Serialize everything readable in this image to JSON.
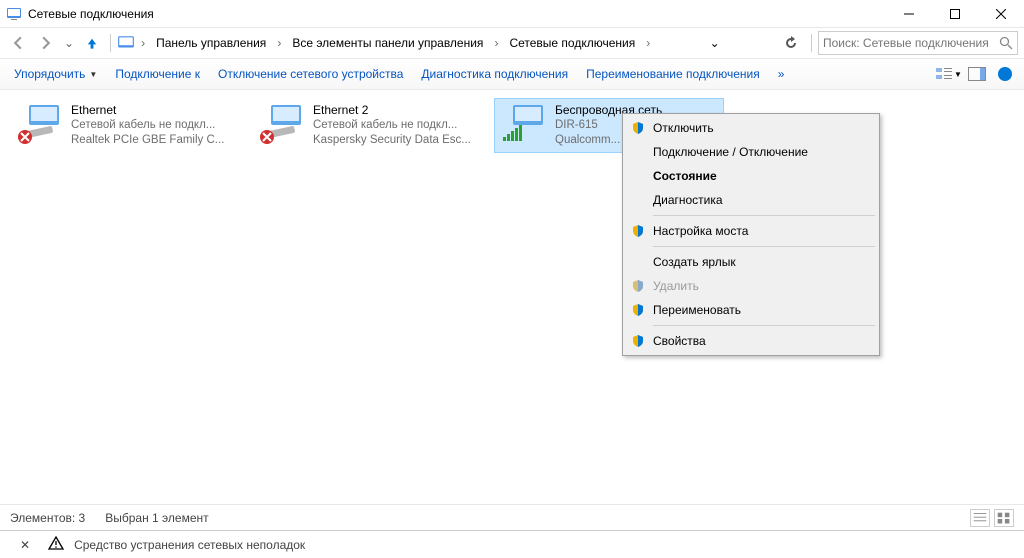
{
  "window": {
    "title": "Сетевые подключения"
  },
  "breadcrumbs": [
    "Панель управления",
    "Все элементы панели управления",
    "Сетевые подключения"
  ],
  "search": {
    "placeholder": "Поиск: Сетевые подключения"
  },
  "toolbar": {
    "organize": "Упорядочить",
    "connect": "Подключение к",
    "disable": "Отключение сетевого устройства",
    "diagnose": "Диагностика подключения",
    "rename": "Переименование подключения",
    "overflow": "»"
  },
  "adapters": [
    {
      "name": "Ethernet",
      "status": "Сетевой кабель не подкл...",
      "device": "Realtek PCIe GBE Family C...",
      "disconnected": true
    },
    {
      "name": "Ethernet 2",
      "status": "Сетевой кабель не подкл...",
      "device": "Kaspersky Security Data Esc...",
      "disconnected": true
    },
    {
      "name": "Беспроводная сеть",
      "status": "DIR-615",
      "device": "Qualcomm...",
      "wifi": true,
      "selected": true
    }
  ],
  "contextmenu": {
    "disable": "Отключить",
    "toggle": "Подключение / Отключение",
    "status": "Состояние",
    "diagnose": "Диагностика",
    "bridge": "Настройка моста",
    "shortcut": "Создать ярлык",
    "delete": "Удалить",
    "rename": "Переименовать",
    "properties": "Свойства"
  },
  "statusbar": {
    "items": "Элементов: 3",
    "selected": "Выбран 1 элемент"
  },
  "troubleshoot": "Средство устранения сетевых неполадок"
}
